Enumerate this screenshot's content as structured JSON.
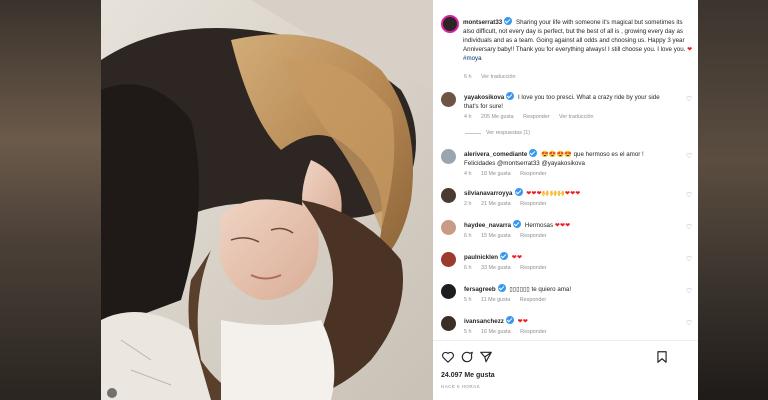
{
  "post": {
    "author": "montserrat33",
    "caption": "Sharing your life with someone it's magical but sometimes its also difficult, not every day is perfect, but the best of all is , growing every day as individuals and as a team. Going against all odds and choosing us. Happy 3 year Anniversary baby!! Thank you for everything always! I still choose you. I love you.",
    "caption_hearts": "❤",
    "hashtag": "#moya",
    "time": "6 h",
    "translate": "Ver traducción"
  },
  "comments": [
    {
      "user": "yayakosikova",
      "verified": true,
      "text": "I love you too presci. What a crazy ride by your side that's for sure!",
      "time": "4 h",
      "likes": "205 Me gusta",
      "reply": "Responder",
      "translate": "Ver traducción"
    },
    {
      "user": "alerivera_comediante",
      "verified": true,
      "emoji": "😍😍😍😍",
      "text": "que hermoso es el amor ! Felicidades @montserrat33 @yayakosikova",
      "time": "4 h",
      "likes": "18 Me gusta",
      "reply": "Responder"
    },
    {
      "user": "silvianavarroyya",
      "verified": true,
      "emoji": "❤❤❤🙌🙌🙌❤❤❤",
      "text": "",
      "time": "2 h",
      "likes": "21 Me gusta",
      "reply": "Responder"
    },
    {
      "user": "haydee_navarra",
      "verified": true,
      "emoji": "",
      "text": "Hermosas",
      "text_emoji": "❤❤❤",
      "time": "6 h",
      "likes": "15 Me gusta",
      "reply": "Responder"
    },
    {
      "user": "paulnicklen",
      "verified": true,
      "emoji": "❤❤",
      "text": "",
      "time": "6 h",
      "likes": "33 Me gusta",
      "reply": "Responder"
    },
    {
      "user": "fersagreeb",
      "verified": true,
      "emoji": "",
      "text": "▯▯▯▯▯▯ te quiero ama!",
      "time": "5 h",
      "likes": "11 Me gusta",
      "reply": "Responder"
    },
    {
      "user": "ivansanchezz",
      "verified": true,
      "emoji": "❤❤",
      "text": "",
      "time": "5 h",
      "likes": "16 Me gusta",
      "reply": "Responder"
    }
  ],
  "replies_toggle": "Ver respuestas (1)",
  "footer": {
    "likes": "24.097 Me gusta",
    "ago": "HACE 6 HORAS"
  },
  "icons": [
    "heart-icon",
    "comment-icon",
    "share-icon",
    "save-icon"
  ],
  "colors": {
    "accent": "#3897f0",
    "heart": "#ed1c24",
    "meta": "#8e8e8e"
  }
}
